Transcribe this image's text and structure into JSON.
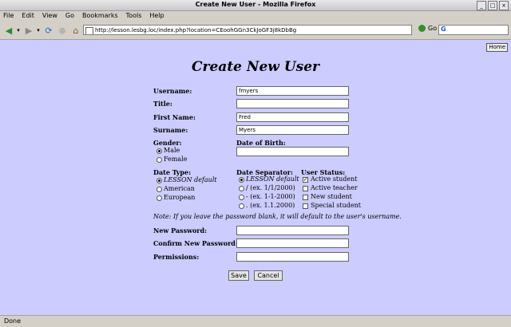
{
  "window": {
    "title": "Create New User - Mozilla Firefox"
  },
  "menu": [
    "File",
    "Edit",
    "View",
    "Go",
    "Bookmarks",
    "Tools",
    "Help"
  ],
  "address": {
    "url": "http://lesson.lesbg.loc/index.php?location=CEoohGGn3CkJoGF3j8kDbBg",
    "go_label": "Go"
  },
  "page": {
    "home_label": "Home",
    "heading": "Create New User",
    "labels": {
      "username": "Username:",
      "title": "Title:",
      "first_name": "First Name:",
      "surname": "Surname:",
      "gender": "Gender:",
      "dob": "Date of Birth:",
      "date_type": "Date Type:",
      "date_separator": "Date Separator:",
      "user_status": "User Status:",
      "new_password": "New Password:",
      "confirm_password": "Confirm New Password:",
      "permissions": "Permissions:"
    },
    "values": {
      "username": "fmyers",
      "title": "",
      "first_name": "Fred",
      "surname": "Myers",
      "dob": "",
      "new_password": "",
      "confirm_password": "",
      "permissions": ""
    },
    "gender_options": [
      "Male",
      "Female"
    ],
    "date_type_options": [
      "LESSON default",
      "American",
      "European"
    ],
    "separator_options": [
      "LESSON default",
      "/ (ex. 1/1/2000)",
      "- (ex. 1-1-2000)",
      ". (ex. 1.1.2000)"
    ],
    "status_options": [
      "Active student",
      "Active teacher",
      "New student",
      "Special student"
    ],
    "note": "Note: If you leave the password blank, it will default to the user's username.",
    "save_label": "Save",
    "cancel_label": "Cancel"
  },
  "status": {
    "text": "Done"
  }
}
